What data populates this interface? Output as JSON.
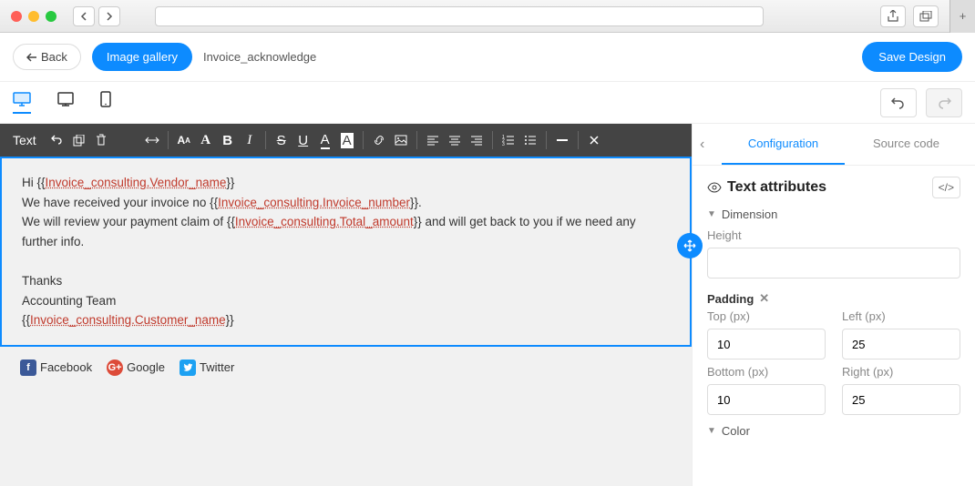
{
  "header": {
    "back_label": "Back",
    "gallery_label": "Image gallery",
    "doc_name": "Invoice_acknowledge",
    "save_label": "Save Design"
  },
  "toolbar": {
    "label": "Text"
  },
  "email_body": {
    "greeting_prefix": "Hi {{",
    "greeting_var": "Invoice_consulting.Vendor_name",
    "greeting_suffix": "}}",
    "line2_prefix": "We have received your invoice no {{",
    "line2_var": "Invoice_consulting.Invoice_number",
    "line2_suffix": "}}.",
    "line3_prefix": "We will review your payment claim of {{",
    "line3_var": "Invoice_consulting.Total_amount",
    "line3_suffix": "}} and will get back to you if we need any further info.",
    "thanks": "Thanks",
    "team": "Accounting Team",
    "sig_prefix": "{{",
    "sig_var": "Invoice_consulting.Customer_name",
    "sig_suffix": "}}"
  },
  "social": {
    "facebook": "Facebook",
    "google": "Google",
    "twitter": "Twitter"
  },
  "props": {
    "tabs": {
      "config": "Configuration",
      "source": "Source code"
    },
    "title": "Text attributes",
    "dimension_label": "Dimension",
    "height_label": "Height",
    "height_value": "",
    "padding_label": "Padding",
    "top_label": "Top (px)",
    "top_value": "10",
    "left_label": "Left (px)",
    "left_value": "25",
    "bottom_label": "Bottom (px)",
    "bottom_value": "10",
    "right_label": "Right (px)",
    "right_value": "25",
    "color_label": "Color"
  }
}
